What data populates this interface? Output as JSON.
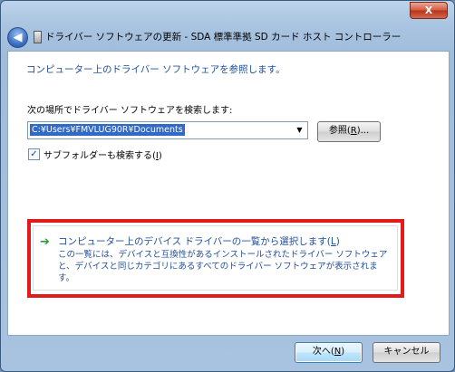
{
  "window": {
    "close_label": "X",
    "title": "ドライバー ソフトウェアの更新 - SDA 標準準拠 SD カード ホスト コントローラー"
  },
  "nav": {
    "back_label": "◀"
  },
  "main": {
    "heading": "コンピューター上のドライバー ソフトウェアを参照します。",
    "search_label": "次の場所でドライバー ソフトウェアを検索します:",
    "path_value": "C:¥Users¥FMVLUG90R¥Documents",
    "browse_label_prefix": "参照(",
    "browse_label_key": "R",
    "browse_label_suffix": ")...",
    "subfolder_checked": true,
    "subfolder_check_glyph": "✓",
    "subfolder_label_prefix": "サブフォルダーも検索する(",
    "subfolder_label_key": "I",
    "subfolder_label_suffix": ")"
  },
  "option": {
    "arrow_glyph": "➔",
    "title_prefix": "コンピューター上のデバイス ドライバーの一覧から選択します(",
    "title_key": "L",
    "title_suffix": ")",
    "description": "この一覧には、デバイスと互換性があるインストールされたドライバー ソフトウェアと、デバイスと同じカテゴリにあるすべてのドライバー ソフトウェアが表示されます。"
  },
  "footer": {
    "next_prefix": "次へ(",
    "next_key": "N",
    "next_suffix": ")",
    "cancel_label": "キャンセル"
  },
  "colors": {
    "link_blue": "#1f4e9b",
    "highlight_red": "#e41a1a",
    "arrow_green": "#2aa033",
    "selection_blue": "#3169c6"
  }
}
